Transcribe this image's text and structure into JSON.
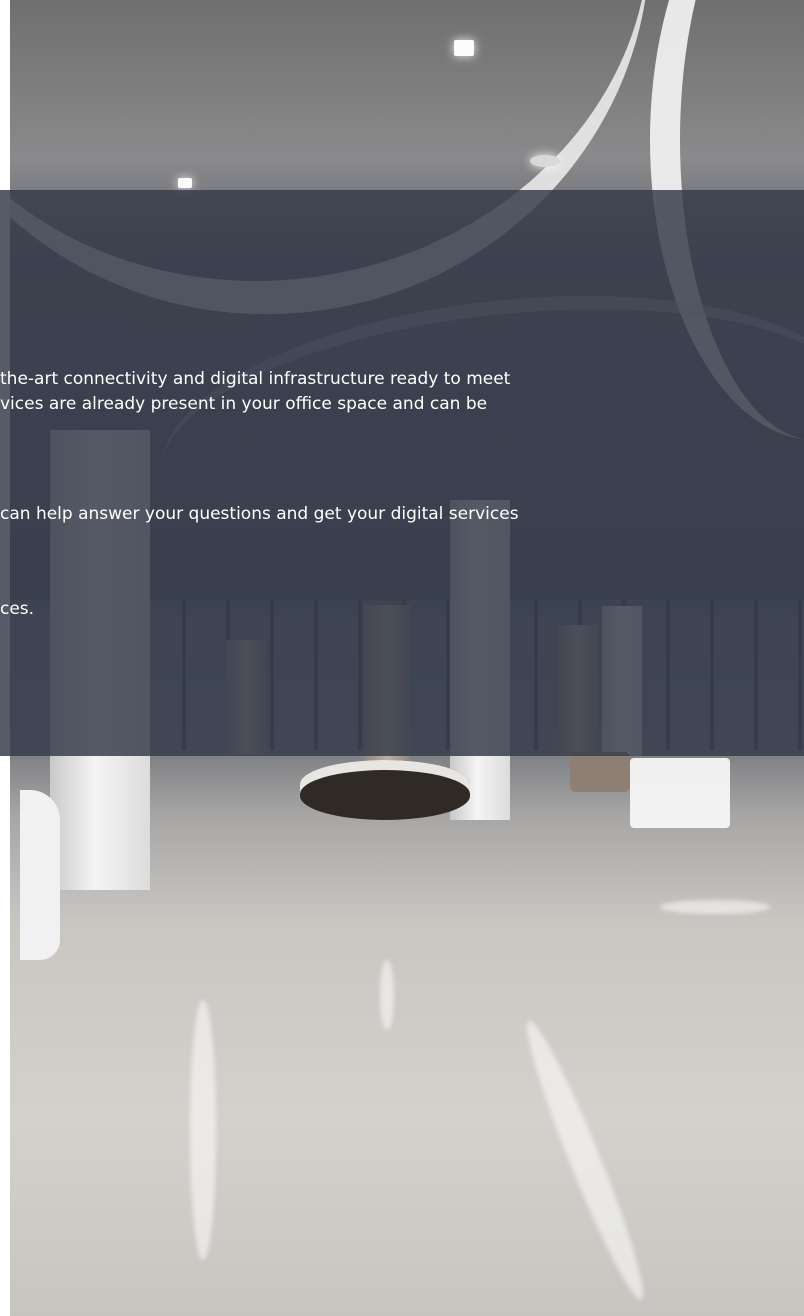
{
  "content_band": {
    "paragraph_1": {
      "line_1": "the-art connectivity and digital infrastructure ready to meet",
      "line_2": "vices are already present in your office space and can be"
    },
    "paragraph_2": {
      "line_1": "can help answer your questions and get your digital services"
    },
    "paragraph_3": {
      "line_1": "ces."
    }
  },
  "colors": {
    "band_overlay": "#363c4a",
    "text": "#ffffff",
    "page_background": "#ffffff"
  }
}
